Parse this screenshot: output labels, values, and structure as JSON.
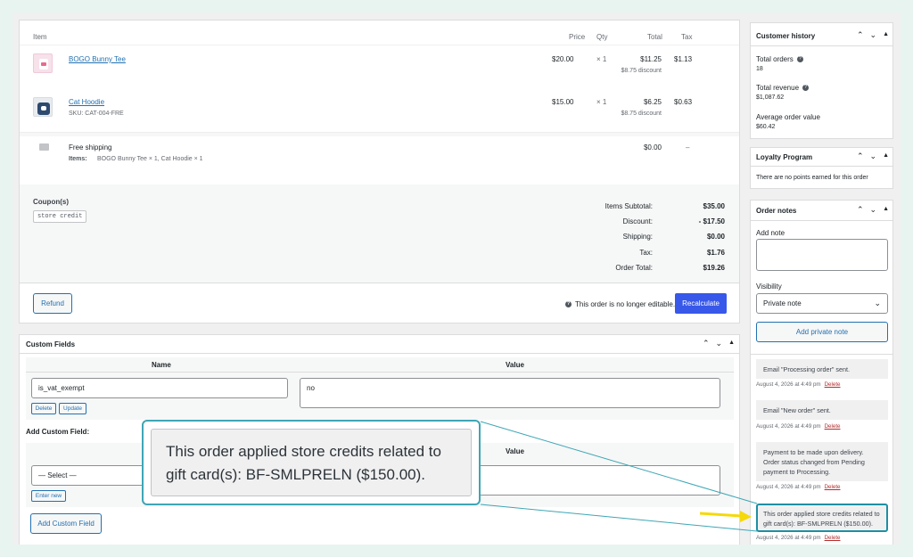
{
  "items_table": {
    "headers": {
      "item": "Item",
      "price": "Price",
      "qty": "Qty",
      "total": "Total",
      "tax": "Tax"
    },
    "rows": [
      {
        "name": "BOGO Bunny Tee",
        "sku": "",
        "price": "$20.00",
        "qty": "× 1",
        "total": "$11.25",
        "discount": "$8.75 discount",
        "tax": "$1.13"
      },
      {
        "name": "Cat Hoodie",
        "sku": "SKU: CAT-004-FRE",
        "price": "$15.00",
        "qty": "× 1",
        "total": "$6.25",
        "discount": "$8.75 discount",
        "tax": "$0.63"
      }
    ],
    "shipping": {
      "name": "Free shipping",
      "items_label": "Items:",
      "items_value": "BOGO Bunny Tee × 1, Cat Hoodie × 1",
      "total": "$0.00",
      "tax": "–"
    }
  },
  "coupons": {
    "label": "Coupon(s)",
    "code": "store credit"
  },
  "totals": [
    {
      "label": "Items Subtotal:",
      "value": "$35.00"
    },
    {
      "label": "Discount:",
      "value": "- $17.50"
    },
    {
      "label": "Shipping:",
      "value": "$0.00"
    },
    {
      "label": "Tax:",
      "value": "$1.76"
    },
    {
      "label": "Order Total:",
      "value": "$19.26"
    }
  ],
  "actions": {
    "refund": "Refund",
    "not_editable": "This order is no longer editable.",
    "recalculate": "Recalculate"
  },
  "custom_fields": {
    "title": "Custom Fields",
    "name_header": "Name",
    "value_header": "Value",
    "field_name": "is_vat_exempt",
    "field_value": "no",
    "delete": "Delete",
    "update": "Update",
    "add_label": "Add Custom Field:",
    "select_placeholder": "— Select —",
    "enter_new": "Enter new",
    "add_button": "Add Custom Field"
  },
  "customer_history": {
    "title": "Customer history",
    "total_orders_label": "Total orders",
    "total_orders": "18",
    "total_revenue_label": "Total revenue",
    "total_revenue": "$1,087.62",
    "aov_label": "Average order value",
    "aov": "$60.42"
  },
  "loyalty": {
    "title": "Loyalty Program",
    "text": "There are no points earned for this order"
  },
  "order_notes": {
    "title": "Order notes",
    "add_note_label": "Add note",
    "visibility_label": "Visibility",
    "visibility_value": "Private note",
    "add_button": "Add private note",
    "notes": [
      {
        "text": "Email \"Processing order\" sent.",
        "meta": "August 4, 2026 at 4:49 pm",
        "delete": "Delete"
      },
      {
        "text": "Email \"New order\" sent.",
        "meta": "August 4, 2026 at 4:49 pm",
        "delete": "Delete"
      },
      {
        "text": "Payment to be made upon delivery. Order status changed from Pending payment to Processing.",
        "meta": "August 4, 2026 at 4:49 pm",
        "delete": "Delete"
      },
      {
        "text": "This order applied store credits related to gift card(s): BF-SMLPRELN ($150.00).",
        "meta": "August 4, 2026 at 4:49 pm",
        "delete": "Delete"
      }
    ]
  },
  "callout": {
    "text": "This order applied store credits related to gift card(s): BF-SMLPRELN ($150.00)."
  },
  "colors": {
    "accent": "#3858e9",
    "link": "#2271b1",
    "highlight": "#1e8fa3",
    "arrow": "#f5d90a"
  }
}
